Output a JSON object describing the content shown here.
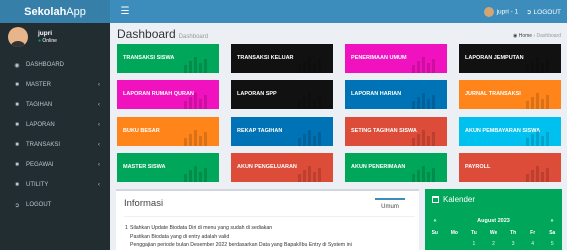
{
  "app": {
    "logo_prefix": "Sekolah",
    "logo_suffix": "App"
  },
  "navbar": {
    "user": "jupri - 1",
    "logout": "LOGOUT"
  },
  "sidebar": {
    "user_name": "jupri",
    "user_status": "Online",
    "items": [
      {
        "label": "DASHBOARD",
        "icon": "dashboard-icon",
        "chevron": false
      },
      {
        "label": "MASTER",
        "icon": "folder-icon",
        "chevron": true
      },
      {
        "label": "TAGIHAN",
        "icon": "folder-icon",
        "chevron": true
      },
      {
        "label": "LAPORAN",
        "icon": "folder-icon",
        "chevron": true
      },
      {
        "label": "TRANSAKSI",
        "icon": "folder-icon",
        "chevron": true
      },
      {
        "label": "PEGAWAI",
        "icon": "folder-icon",
        "chevron": true
      },
      {
        "label": "UTILITY",
        "icon": "folder-icon",
        "chevron": true
      },
      {
        "label": "LOGOUT",
        "icon": "sign-out-icon",
        "chevron": false
      }
    ]
  },
  "page": {
    "title": "Dashboard",
    "subtitle": "Dashboard"
  },
  "breadcrumb": {
    "home": "Home",
    "current": "Dashboard"
  },
  "tiles": [
    {
      "label": "TRANSAKSI SISWA",
      "color": "#00a65a"
    },
    {
      "label": "TRANSAKSI KELUAR",
      "color": "#111111"
    },
    {
      "label": "PENERIMAAN UMUM",
      "color": "#f012be"
    },
    {
      "label": "LAPORAN JEMPUTAN",
      "color": "#111111"
    },
    {
      "label": "LAPORAN RUMAH QURAN",
      "color": "#f012be"
    },
    {
      "label": "LAPORAN SPP",
      "color": "#111111"
    },
    {
      "label": "LAPORAN HARIAN",
      "color": "#0073b7"
    },
    {
      "label": "JURNAL TRANSAKSI",
      "color": "#ff851b"
    },
    {
      "label": "BUKU BESAR",
      "color": "#ff851b"
    },
    {
      "label": "REKAP TAGIHAN",
      "color": "#0073b7"
    },
    {
      "label": "SETING TAGIHAN SISWA",
      "color": "#dd4b39"
    },
    {
      "label": "AKUN PEMBAYARAN SISWA",
      "color": "#00c0ef"
    },
    {
      "label": "MASTER SISWA",
      "color": "#00a65a"
    },
    {
      "label": "AKUN PENGELUARAN",
      "color": "#dd4b39"
    },
    {
      "label": "AKUN PENERIMAAN",
      "color": "#00a65a"
    },
    {
      "label": "PAYROLL",
      "color": "#dd4b39"
    }
  ],
  "informasi": {
    "title": "Informasi",
    "tab": "Umum",
    "number": "1",
    "lines": [
      "Silahkan Update Biodata Diri di menu yang sudah di sediakan",
      "Pastikan Biodata yang di entry adalah valid",
      "Penggajian periode bulan Desember 2022 berdasarkan Data yang Bapak/Ibu Entry di System ini"
    ]
  },
  "kalender": {
    "title": "Kalender",
    "month": "August 2023",
    "prev": "«",
    "next": "»",
    "days": [
      "Su",
      "Mo",
      "Tu",
      "We",
      "Th",
      "Fr",
      "Sa"
    ],
    "first_row": [
      "",
      "",
      "1",
      "2",
      "3",
      "4",
      "5"
    ]
  }
}
